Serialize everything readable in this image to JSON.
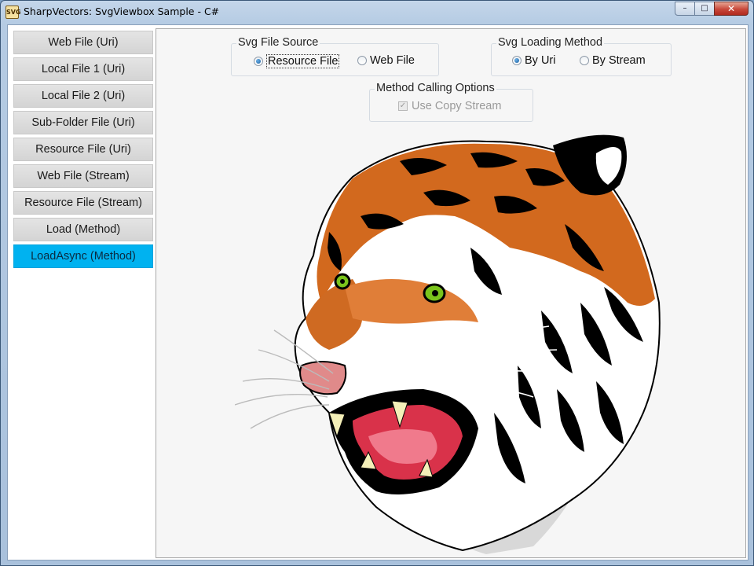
{
  "window": {
    "title": "SharpVectors: SvgViewbox Sample - C#",
    "app_icon_text": "SVG",
    "minimize_glyph": "–",
    "maximize_glyph": "□",
    "close_glyph": "✕"
  },
  "sidebar": {
    "items": [
      {
        "label": "Web File (Uri)",
        "active": false
      },
      {
        "label": "Local File 1 (Uri)",
        "active": false
      },
      {
        "label": "Local File 2 (Uri)",
        "active": false
      },
      {
        "label": "Sub-Folder File (Uri)",
        "active": false
      },
      {
        "label": "Resource File (Uri)",
        "active": false
      },
      {
        "label": "Web File (Stream)",
        "active": false
      },
      {
        "label": "Resource File (Stream)",
        "active": false
      },
      {
        "label": "Load (Method)",
        "active": false
      },
      {
        "label": "LoadAsync (Method)",
        "active": true
      }
    ],
    "active_color": "#00b2f0"
  },
  "svg_file_source": {
    "title": "Svg File Source",
    "options": [
      {
        "label": "Resource File",
        "checked": true
      },
      {
        "label": "Web File",
        "checked": false
      }
    ]
  },
  "svg_loading_method": {
    "title": "Svg Loading Method",
    "options": [
      {
        "label": "By Uri",
        "checked": true
      },
      {
        "label": "By Stream",
        "checked": false
      }
    ]
  },
  "method_calling_options": {
    "title": "Method Calling Options",
    "checkbox_label": "Use Copy Stream",
    "checked": true,
    "enabled": false
  },
  "viewer": {
    "image_subject": "tiger-head-svg"
  },
  "colors": {
    "tiger_orange": "#d2691e",
    "tiger_black": "#000000",
    "eye_green": "#7ac41c",
    "nose_pink": "#e08a8a",
    "mouth_red": "#d9324a"
  }
}
